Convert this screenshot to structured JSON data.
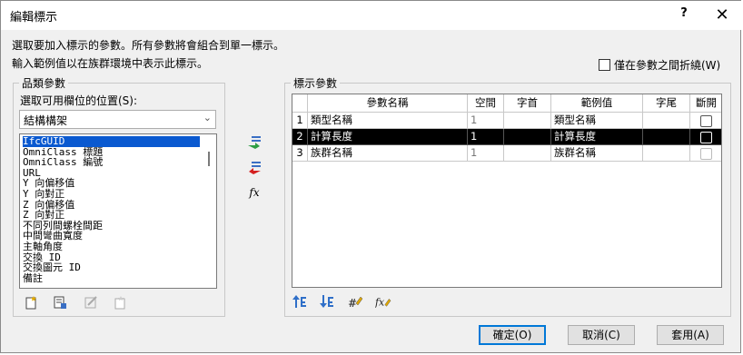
{
  "window": {
    "title": "編輯標示",
    "help_label": "?",
    "close_label": "✕"
  },
  "description": {
    "line1": "選取要加入標示的參數。所有參數將會組合到單一標示。",
    "line2": "輸入範例值以在族群環境中表示此標示。"
  },
  "wrap_option": {
    "label": "僅在參數之間折繞(W)",
    "checked": false
  },
  "category_group": {
    "title": "品類參數",
    "select_label": "選取可用欄位的位置(S):",
    "selected_value": "結構構架",
    "fields": [
      "IfcGUID",
      "OmniClass 標題",
      "OmniClass 編號",
      "URL",
      "Y 向偏移值",
      "Y 向對正",
      "Z 向偏移值",
      "Z 向對正",
      "不同列間螺栓間距",
      "中間彎曲寬度",
      "主軸角度",
      "交換 ID",
      "交換圖元 ID",
      "備註"
    ],
    "selected_index": 0,
    "icons": [
      "new-parameter-icon",
      "edit-parameter-icon",
      "modify-icon",
      "delete-parameter-icon"
    ]
  },
  "transfer": {
    "add_icon": "add-arrow-icon",
    "remove_icon": "remove-arrow-icon",
    "formula_label": "fx"
  },
  "label_group": {
    "title": "標示參數",
    "columns": [
      "參數名稱",
      "空間",
      "字首",
      "範例值",
      "字尾",
      "斷開"
    ],
    "rows": [
      {
        "num": "1",
        "name": "類型名稱",
        "space": "1",
        "prefix": "",
        "sample": "類型名稱",
        "suffix": "",
        "break": false
      },
      {
        "num": "2",
        "name": "計算長度",
        "space": "1",
        "prefix": "",
        "sample": "計算長度",
        "suffix": "",
        "break": false
      },
      {
        "num": "3",
        "name": "族群名稱",
        "space": "1",
        "prefix": "",
        "sample": "族群名稱",
        "suffix": "",
        "break": false
      }
    ],
    "selected_row": 1,
    "toolbar": [
      "move-up-icon",
      "move-down-icon",
      "edit-format-icon",
      "edit-formula-icon"
    ]
  },
  "buttons": {
    "ok": "確定(O)",
    "cancel": "取消(C)",
    "apply": "套用(A)"
  },
  "colors": {
    "selection": "#0a59d0",
    "row_highlight": "#000000",
    "default_button_border": "#0078d7"
  }
}
